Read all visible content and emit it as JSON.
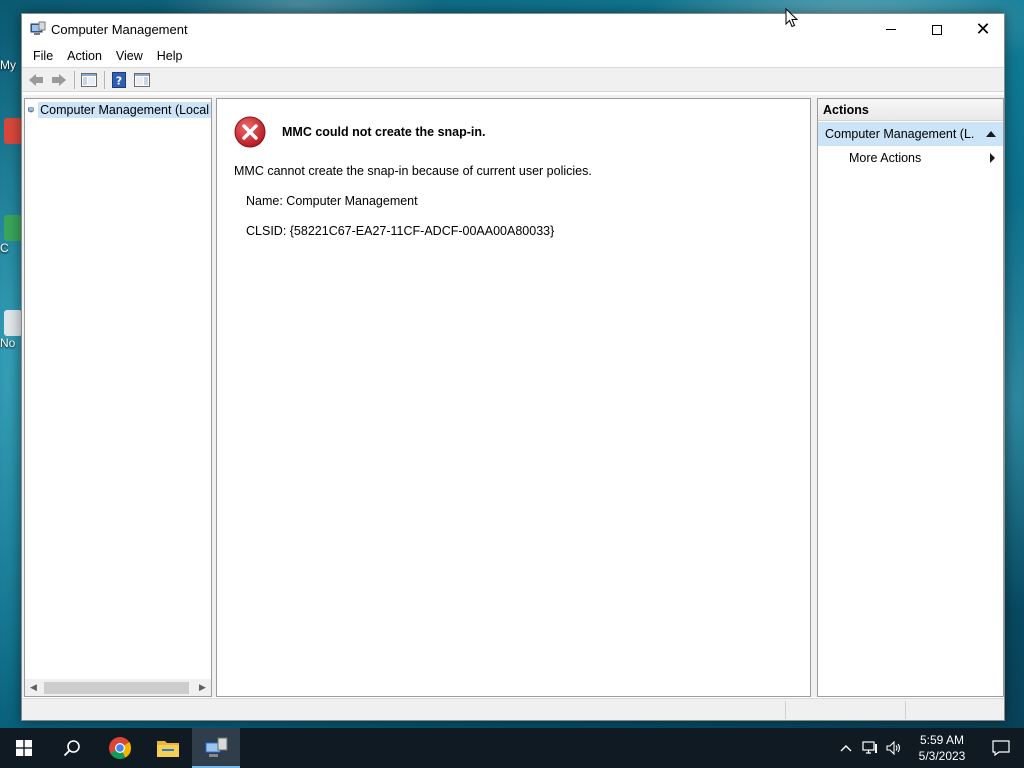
{
  "window": {
    "title": "Computer Management",
    "menu": [
      "File",
      "Action",
      "View",
      "Help"
    ]
  },
  "tree": {
    "root_label": "Computer Management (Local"
  },
  "error": {
    "title": "MMC could not create the snap-in.",
    "message": "MMC cannot create the snap-in because of current user policies.",
    "name_line": "Name: Computer Management",
    "clsid_line": "CLSID: {58221C67-EA27-11CF-ADCF-00AA00A80033}"
  },
  "actions": {
    "header": "Actions",
    "section": "Computer Management (L...",
    "items": [
      "More Actions"
    ]
  },
  "desktop": {
    "icon_labels": [
      "My",
      "C",
      "No"
    ]
  },
  "taskbar": {
    "time": "5:59 AM",
    "date": "5/3/2023"
  },
  "colors": {
    "selection": "#cce4f7",
    "error_red": "#c4262e",
    "taskbar": "#0f1a22",
    "taskbar_accent": "#76b9ed"
  }
}
